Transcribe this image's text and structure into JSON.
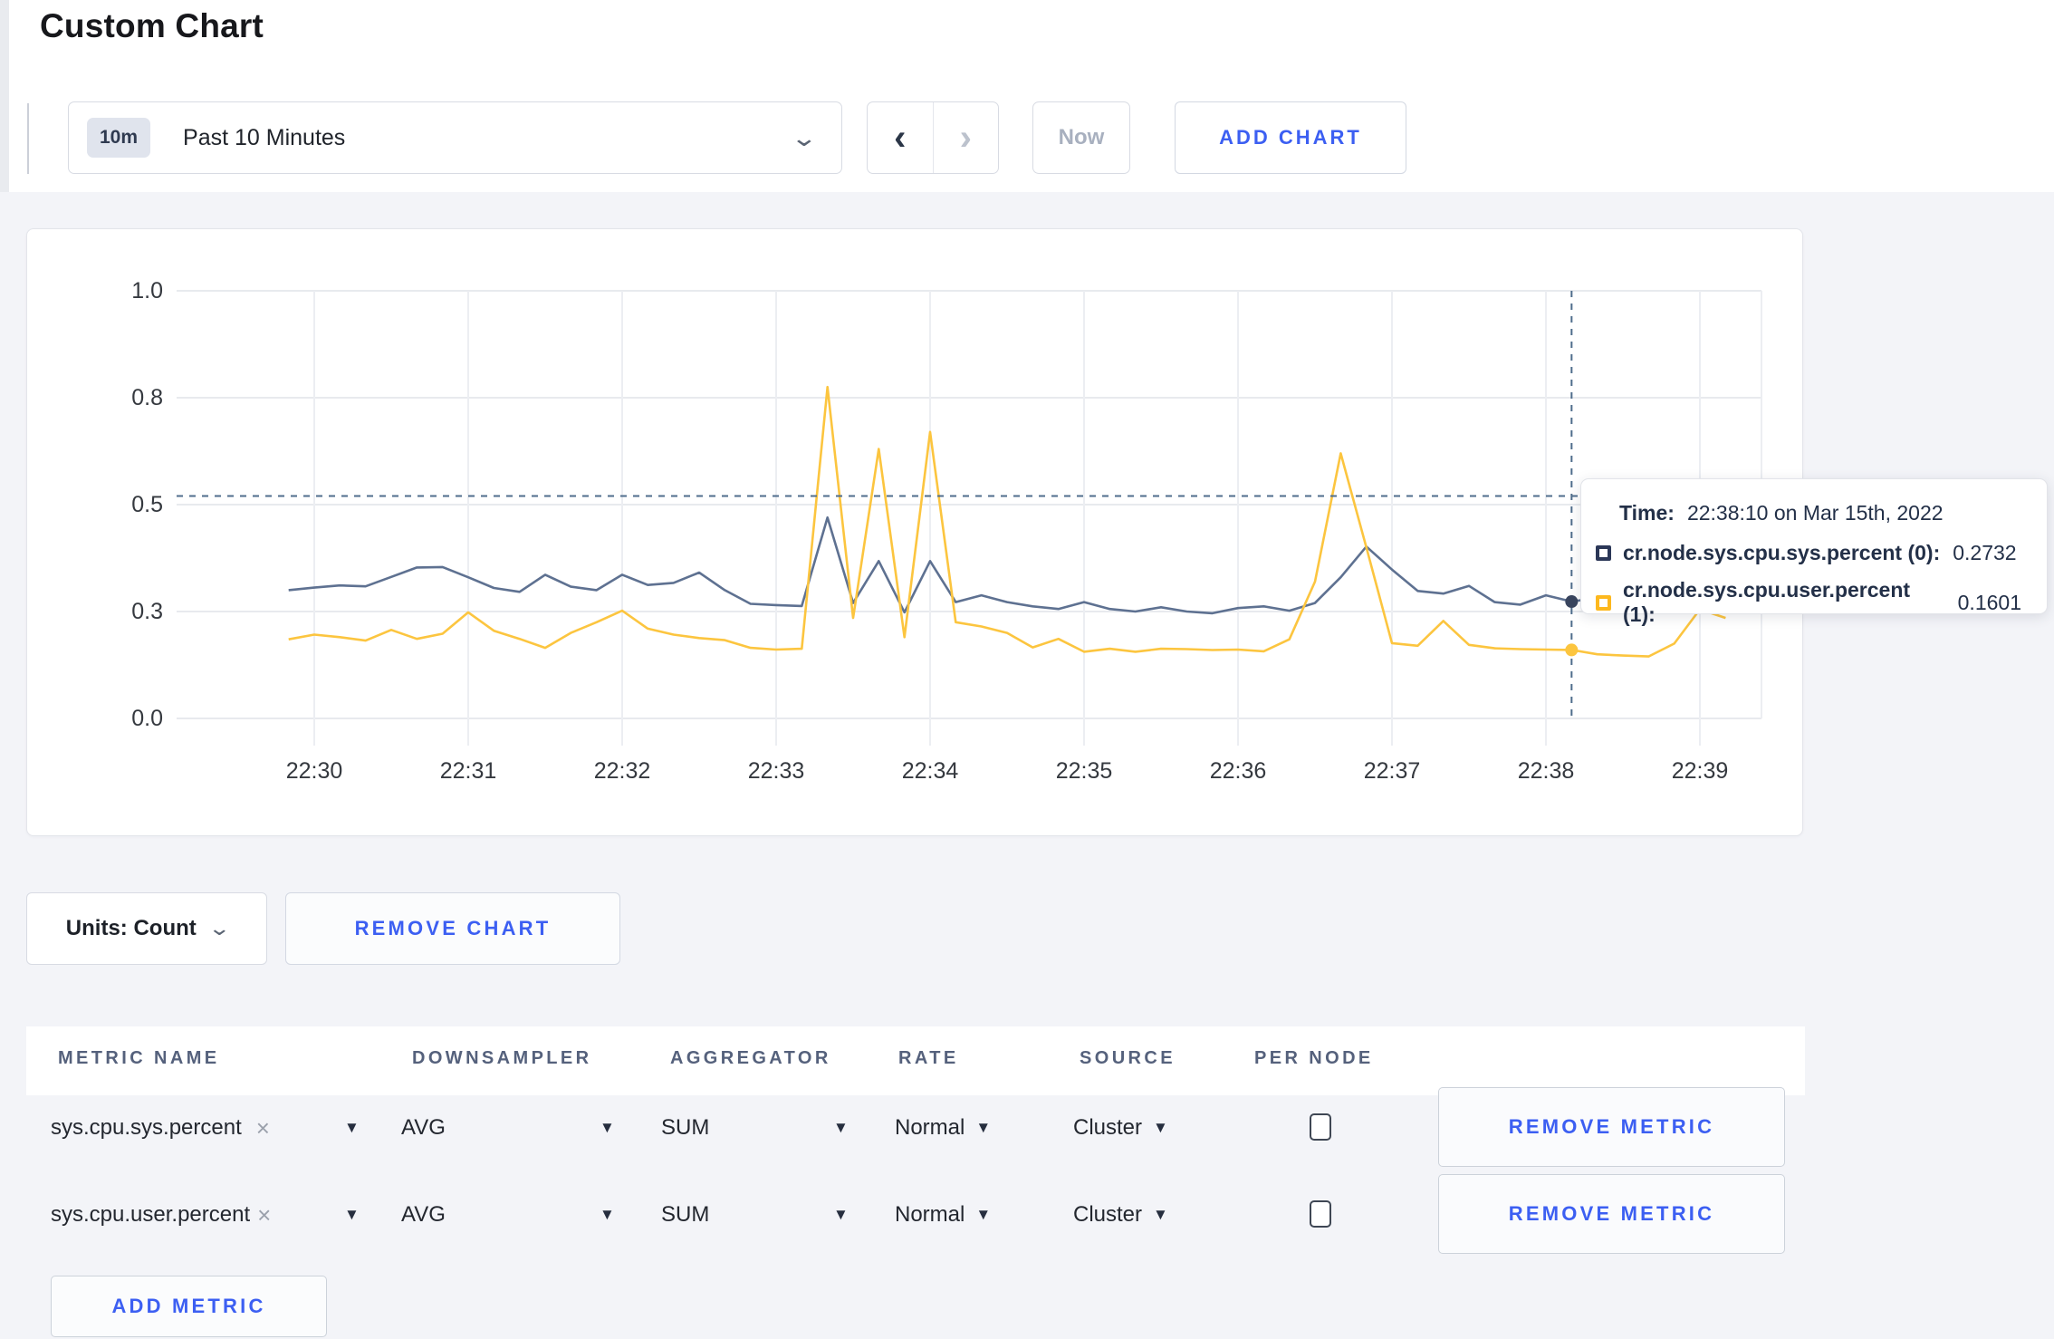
{
  "page": {
    "title": "Custom Chart"
  },
  "toolbar": {
    "range_badge": "10m",
    "range_label": "Past 10 Minutes",
    "caret_icon": "⌄",
    "prev_icon": "‹",
    "next_icon": "›",
    "now_label": "Now",
    "add_chart_label": "ADD CHART"
  },
  "colors": {
    "accent_blue": "#3c5ff2",
    "series_sys": "#5e7191",
    "series_user": "#fcc53f",
    "crosshair": "#4f6d8c",
    "grid": "#e8eaee",
    "axis_text": "#35393f"
  },
  "chart_data": {
    "type": "line",
    "title": "",
    "xlabel": "",
    "ylabel": "",
    "x_axis": {
      "tick_labels": [
        "22:30",
        "22:31",
        "22:32",
        "22:33",
        "22:34",
        "22:35",
        "22:36",
        "22:37",
        "22:38",
        "22:39"
      ]
    },
    "y_axis": {
      "tick_labels": [
        "0.0",
        "0.3",
        "0.5",
        "0.8",
        "1.0"
      ],
      "tick_values": [
        0,
        0.25,
        0.5,
        0.75,
        1.0
      ],
      "range": [
        0,
        1
      ]
    },
    "grid": true,
    "legend_position": "tooltip-only",
    "sample_start_minutes": -0.16667,
    "sample_step_minutes": 0.16667,
    "series": [
      {
        "name": "cr.node.sys.cpu.sys.percent",
        "node_id": "(0)",
        "color": "#5e7191",
        "values": [
          0.3,
          0.306,
          0.311,
          0.309,
          0.331,
          0.353,
          0.354,
          0.33,
          0.305,
          0.296,
          0.336,
          0.308,
          0.3,
          0.336,
          0.312,
          0.317,
          0.341,
          0.3,
          0.268,
          0.265,
          0.263,
          0.47,
          0.27,
          0.368,
          0.248,
          0.368,
          0.272,
          0.288,
          0.272,
          0.262,
          0.256,
          0.272,
          0.256,
          0.25,
          0.26,
          0.25,
          0.246,
          0.258,
          0.262,
          0.252,
          0.27,
          0.33,
          0.402,
          0.348,
          0.298,
          0.292,
          0.31,
          0.272,
          0.266,
          0.288,
          0.2732,
          0.282,
          0.302,
          0.288,
          0.286,
          0.295,
          0.3
        ]
      },
      {
        "name": "cr.node.sys.cpu.user.percent",
        "node_id": "(1)",
        "color": "#fcc53f",
        "values": [
          0.185,
          0.196,
          0.19,
          0.182,
          0.207,
          0.186,
          0.198,
          0.248,
          0.205,
          0.186,
          0.165,
          0.2,
          0.225,
          0.252,
          0.21,
          0.196,
          0.188,
          0.183,
          0.165,
          0.161,
          0.163,
          0.775,
          0.235,
          0.63,
          0.19,
          0.67,
          0.225,
          0.215,
          0.2,
          0.166,
          0.186,
          0.156,
          0.163,
          0.156,
          0.163,
          0.162,
          0.16,
          0.161,
          0.157,
          0.185,
          0.32,
          0.62,
          0.4,
          0.176,
          0.17,
          0.228,
          0.172,
          0.164,
          0.162,
          0.161,
          0.1601,
          0.15,
          0.147,
          0.145,
          0.175,
          0.255,
          0.235
        ]
      }
    ],
    "crosshair": {
      "time_minutes": 8.16667,
      "hover_value": 0.52,
      "point_values": [
        0.2732,
        0.1601
      ]
    }
  },
  "tooltip": {
    "time_label": "Time:",
    "time_value": "22:38:10 on Mar 15th, 2022",
    "rows": [
      {
        "label": "cr.node.sys.cpu.sys.percent (0):",
        "value": "0.2732",
        "swatch_color": "#2b3757"
      },
      {
        "label": "cr.node.sys.cpu.user.percent (1):",
        "value": "0.1601",
        "swatch_color": "#fdb81e"
      }
    ]
  },
  "units_bar": {
    "units_label": "Units: Count",
    "caret_icon": "⌄",
    "remove_chart_label": "REMOVE CHART"
  },
  "metrics_table": {
    "headers": [
      "METRIC NAME",
      "DOWNSAMPLER",
      "AGGREGATOR",
      "RATE",
      "SOURCE",
      "PER NODE"
    ],
    "clear_icon": "×",
    "caret_icon": "▼",
    "rows": [
      {
        "metric": "sys.cpu.sys.percent",
        "downsampler": "AVG",
        "aggregator": "SUM",
        "rate": "Normal",
        "source": "Cluster",
        "per_node_checked": false,
        "remove_label": "REMOVE METRIC"
      },
      {
        "metric": "sys.cpu.user.percent",
        "downsampler": "AVG",
        "aggregator": "SUM",
        "rate": "Normal",
        "source": "Cluster",
        "per_node_checked": false,
        "remove_label": "REMOVE METRIC"
      }
    ],
    "add_metric_label": "ADD METRIC"
  }
}
